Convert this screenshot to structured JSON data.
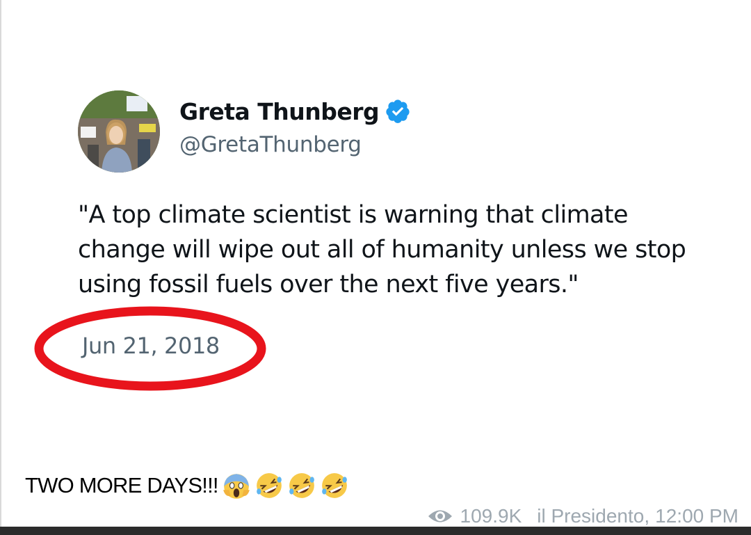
{
  "tweet": {
    "display_name": "Greta Thunberg",
    "handle": "@GretaThunberg",
    "verified": true,
    "text": "\"A top climate scientist is warning that climate change will wipe out all of humanity unless we stop using fossil fuels over the next five years.\"",
    "date": "Jun 21, 2018"
  },
  "post": {
    "caption": "TWO MORE DAYS!!!",
    "emojis": [
      "scream-emoji",
      "rofl-emoji",
      "rofl-emoji",
      "rofl-emoji"
    ],
    "views": "109.9K",
    "author": "il Presidento,",
    "time": "12:00 PM"
  },
  "colors": {
    "verified_blue": "#1d9bf0",
    "annotation_red": "#e8141c",
    "meta_gray": "#9ea8b0"
  }
}
